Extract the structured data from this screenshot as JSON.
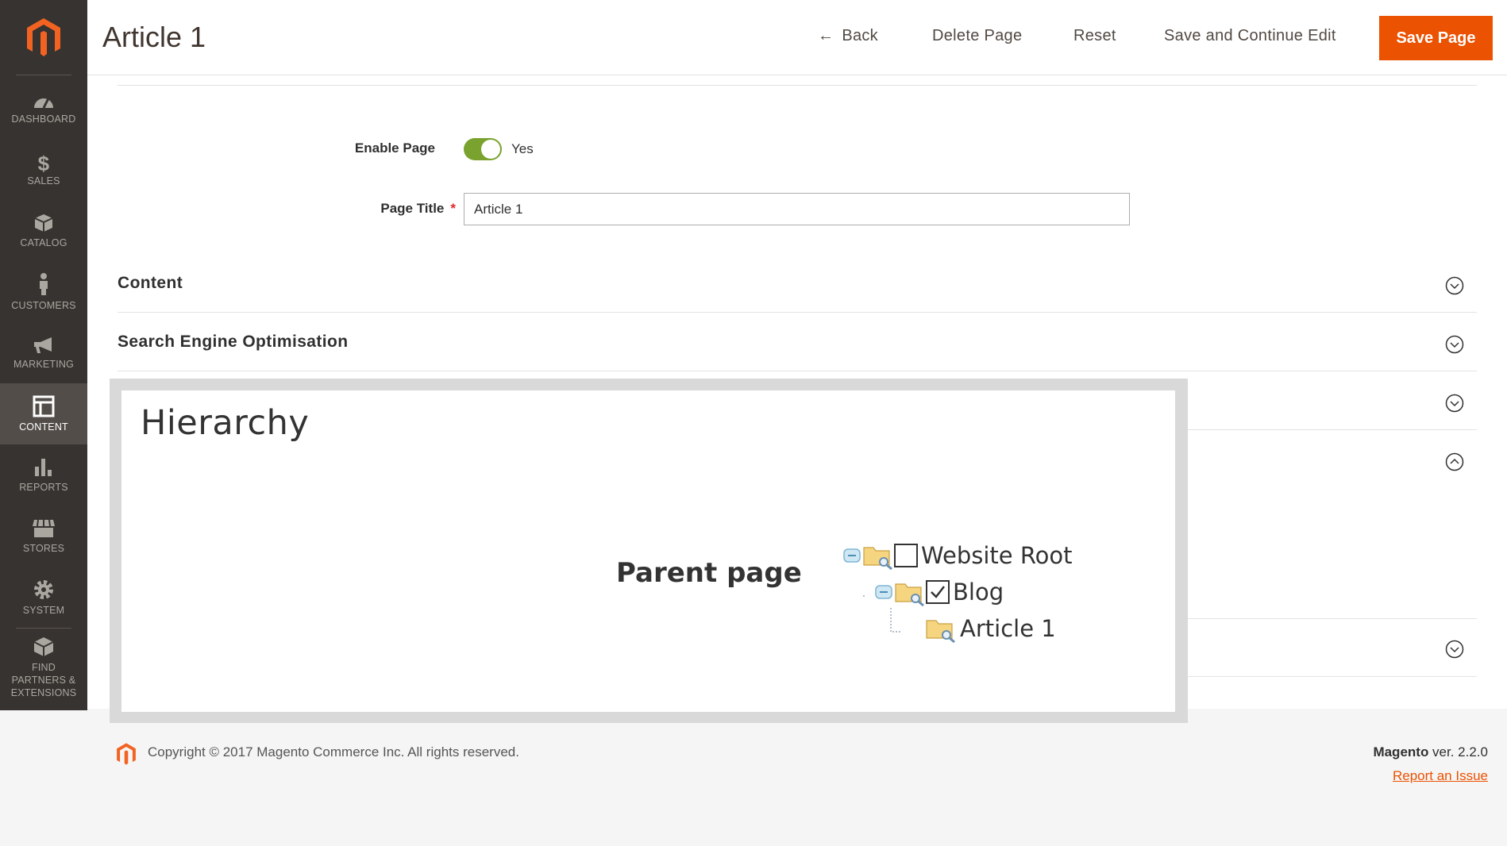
{
  "sidebar": {
    "items": [
      {
        "label": "DASHBOARD",
        "icon": "dashboard-icon"
      },
      {
        "label": "SALES",
        "icon": "dollar-icon"
      },
      {
        "label": "CATALOG",
        "icon": "cube-icon"
      },
      {
        "label": "CUSTOMERS",
        "icon": "person-icon"
      },
      {
        "label": "MARKETING",
        "icon": "megaphone-icon"
      },
      {
        "label": "CONTENT",
        "icon": "layout-icon"
      },
      {
        "label": "REPORTS",
        "icon": "bar-chart-icon"
      },
      {
        "label": "STORES",
        "icon": "store-icon"
      },
      {
        "label": "SYSTEM",
        "icon": "gear-icon"
      },
      {
        "label": "FIND PARTNERS & EXTENSIONS",
        "icon": "box-icon"
      }
    ],
    "active": "CONTENT"
  },
  "header": {
    "title": "Article 1",
    "back_label": "Back",
    "delete_label": "Delete Page",
    "reset_label": "Reset",
    "save_continue_label": "Save and Continue Edit",
    "save_label": "Save Page"
  },
  "form": {
    "enable_label": "Enable Page",
    "enable_value": "Yes",
    "title_label": "Page Title",
    "title_value": "Article 1"
  },
  "sections": {
    "content": "Content",
    "seo": "Search Engine Optimisation"
  },
  "hierarchy": {
    "title": "Hierarchy",
    "parent_label": "Parent page",
    "tree": [
      {
        "label": "Website Root",
        "checked": false
      },
      {
        "label": "Blog",
        "checked": true
      },
      {
        "label": "Article 1"
      }
    ]
  },
  "footer": {
    "copyright": "Copyright © 2017 Magento Commerce Inc. All rights reserved.",
    "brand": "Magento",
    "version": " ver. 2.2.0",
    "report": "Report an Issue"
  },
  "colors": {
    "accent": "#eb5202",
    "sidebar": "#373330",
    "toggle_on": "#79a22e"
  }
}
